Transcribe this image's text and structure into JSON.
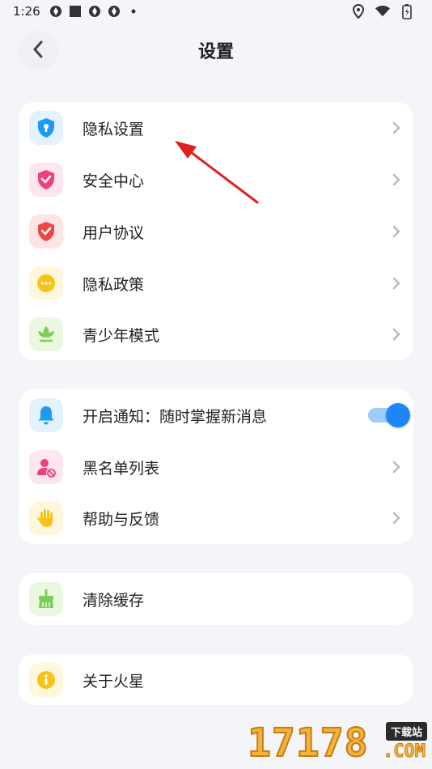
{
  "status_bar": {
    "time": "1:26"
  },
  "header": {
    "title": "设置"
  },
  "group1": [
    {
      "label": "隐私设置",
      "icon": "shield-keyhole-icon",
      "color": "#1e9bf0",
      "bg": "#e3f3fe"
    },
    {
      "label": "安全中心",
      "icon": "shield-check-icon",
      "color": "#f0407a",
      "bg": "#fde6ee"
    },
    {
      "label": "用户协议",
      "icon": "shield-check-icon",
      "color": "#f04545",
      "bg": "#fde5e5"
    },
    {
      "label": "隐私政策",
      "icon": "chat-bubble-icon",
      "color": "#f7c31a",
      "bg": "#fef7dc"
    },
    {
      "label": "青少年模式",
      "icon": "sprout-icon",
      "color": "#7ccf55",
      "bg": "#eaf8e2"
    }
  ],
  "group2": [
    {
      "label": "开启通知：随时掌握新消息",
      "icon": "bell-icon",
      "color": "#1e9bf0",
      "bg": "#e3f3fe",
      "toggle_on": true
    },
    {
      "label": "黑名单列表",
      "icon": "user-block-icon",
      "color": "#f0407a",
      "bg": "#fde6ee"
    },
    {
      "label": "帮助与反馈",
      "icon": "hand-icon",
      "color": "#f7c31a",
      "bg": "#fef7dc"
    }
  ],
  "group3": [
    {
      "label": "清除缓存",
      "icon": "broom-icon",
      "color": "#7ccf55",
      "bg": "#eaf8e2"
    }
  ],
  "group4": [
    {
      "label": "关于火星",
      "icon": "info-icon",
      "color": "#f7c31a",
      "bg": "#fef7dc"
    }
  ],
  "watermark": {
    "number": "17178",
    "tag": "下载站",
    "domain": ".COM"
  },
  "colors": {
    "background": "#f4f5f9",
    "card": "#ffffff",
    "accent": "#1e86f5",
    "annotation": "#e02020"
  }
}
